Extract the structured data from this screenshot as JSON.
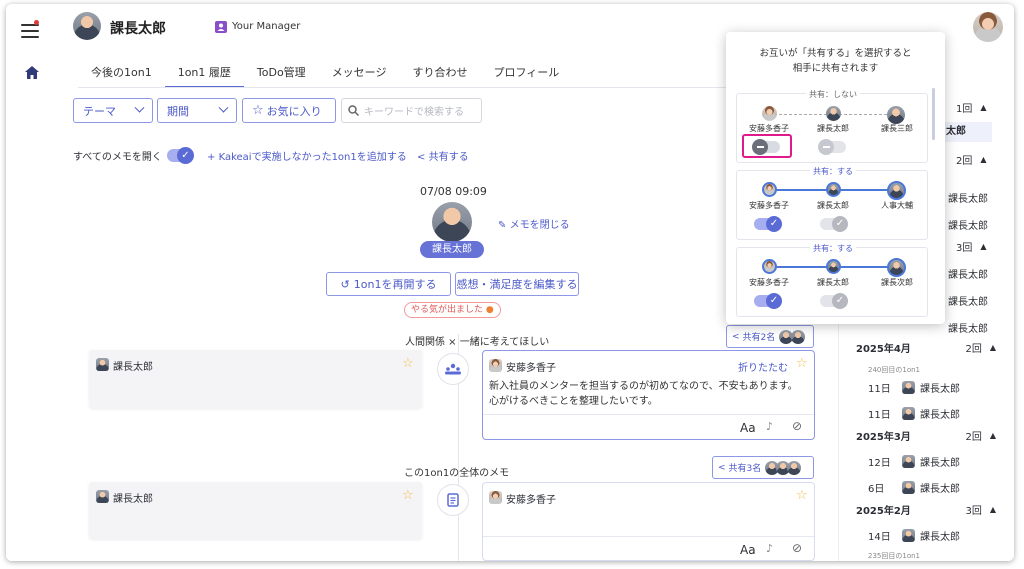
{
  "header": {
    "user_name": "課長太郎",
    "manager_label": "Your Manager"
  },
  "tabs": [
    "今後の1on1",
    "1on1 履歴",
    "ToDo管理",
    "メッセージ",
    "すり合わせ",
    "プロフィール"
  ],
  "filters": {
    "theme": "テーマ",
    "period": "期間",
    "favorite": "お気に入り",
    "search_placeholder": "キーワードで検索する"
  },
  "options": {
    "open_all_memos": "すべてのメモを開く",
    "add_session": "Kakeaiで実施しなかった1on1を追加する",
    "share": "共有する"
  },
  "session": {
    "datetime": "07/08 09:09",
    "close_memo": "メモを閉じる",
    "person": "課長太郎",
    "reopen": "1on1を再開する",
    "edit_feedback": "感想・満足度を編集する",
    "badge": "やる気が出ました"
  },
  "topics": [
    {
      "title": "人間関係 × 一緒に考えてほしい",
      "share_label": "共有2名",
      "left_author": "課長太郎",
      "right_author": "安藤多香子",
      "fold": "折りたたむ",
      "content": "新入社員のメンターを担当するのが初めてなので、不安もあります。心がけるべきことを整理したいです。",
      "font_label": "Aa"
    },
    {
      "title": "この1on1の全体のメモ",
      "share_label": "共有3名",
      "left_author": "課長太郎",
      "right_author": "安藤多香子",
      "font_label": "Aa"
    }
  ],
  "share_popup": {
    "description_line1": "お互いが「共有する」を選択すると",
    "description_line2": "相手に共有されます",
    "groups": [
      {
        "header": "共有：しない",
        "names": [
          "安藤多香子",
          "課長太郎",
          "課長三郎"
        ],
        "state": "off"
      },
      {
        "header": "共有：する",
        "names": [
          "安藤多香子",
          "課長太郎",
          "人事大輔"
        ],
        "state": "on"
      },
      {
        "header": "共有：する",
        "names": [
          "安藤多香子",
          "課長太郎",
          "課長次郎"
        ],
        "state": "on"
      }
    ]
  },
  "history": {
    "top_count": "1回",
    "top_name": "太郎",
    "second_count": "2回",
    "rows_name": "課長太郎",
    "third_count": "3回",
    "sections": [
      {
        "month": "2025年4月",
        "count": "2回",
        "note": "240回目の1on1",
        "days": [
          "11日",
          "11日"
        ]
      },
      {
        "month": "2025年3月",
        "count": "2回",
        "days": [
          "12日",
          "6日"
        ]
      },
      {
        "month": "2025年2月",
        "count": "3回",
        "days": [
          "14日"
        ],
        "note2": "235回目の1on1"
      }
    ]
  },
  "colors": {
    "accent": "#5b6bd6",
    "highlight": "#e0198c",
    "star": "#f0c040"
  }
}
